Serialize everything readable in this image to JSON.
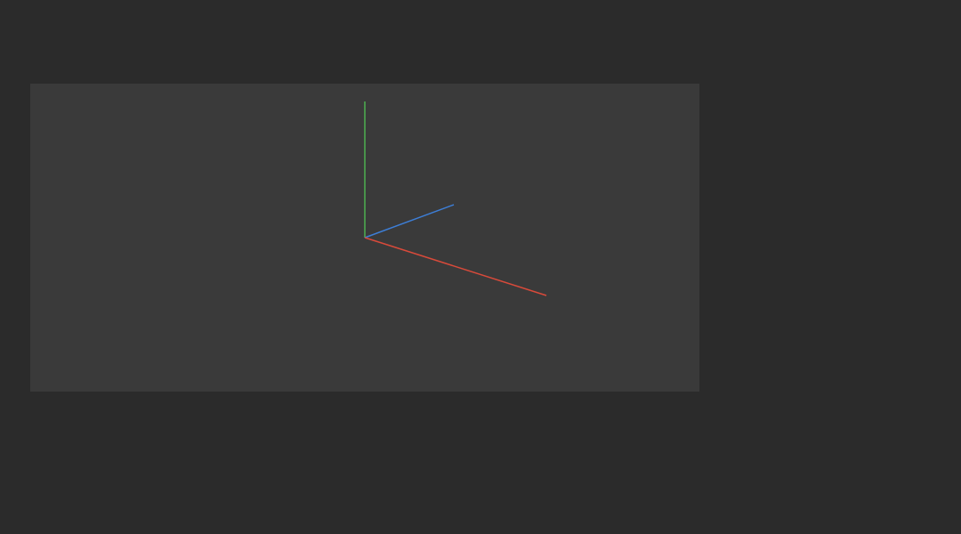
{
  "viewport": {
    "axis_colors": {
      "y": "#4caf50",
      "z": "#3d7ed6",
      "x": "#d84a3a"
    }
  }
}
